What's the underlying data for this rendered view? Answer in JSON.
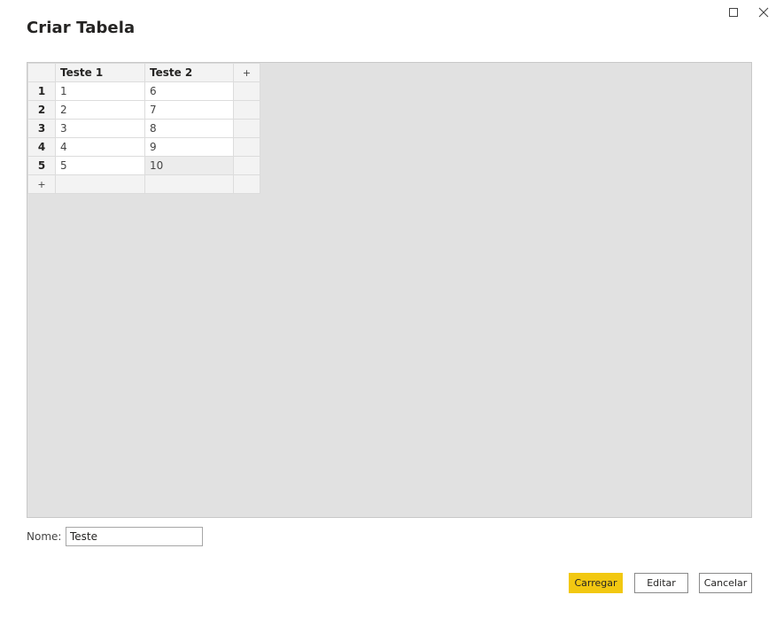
{
  "dialog": {
    "title": "Criar Tabela"
  },
  "table": {
    "add_column_label": "+",
    "add_row_label": "+",
    "columns": [
      "Teste 1",
      "Teste 2"
    ],
    "rows": [
      {
        "num": "1",
        "cells": [
          "1",
          "6"
        ]
      },
      {
        "num": "2",
        "cells": [
          "2",
          "7"
        ]
      },
      {
        "num": "3",
        "cells": [
          "3",
          "8"
        ]
      },
      {
        "num": "4",
        "cells": [
          "4",
          "9"
        ]
      },
      {
        "num": "5",
        "cells": [
          "5",
          "10"
        ]
      }
    ]
  },
  "name_field": {
    "label": "Nome:",
    "value": "Teste"
  },
  "buttons": {
    "load": "Carregar",
    "edit": "Editar",
    "cancel": "Cancelar"
  },
  "colors": {
    "accent": "#f2c811",
    "grid_background": "#e1e1e1"
  },
  "icons": {
    "maximize": "maximize-icon",
    "close": "close-icon"
  }
}
